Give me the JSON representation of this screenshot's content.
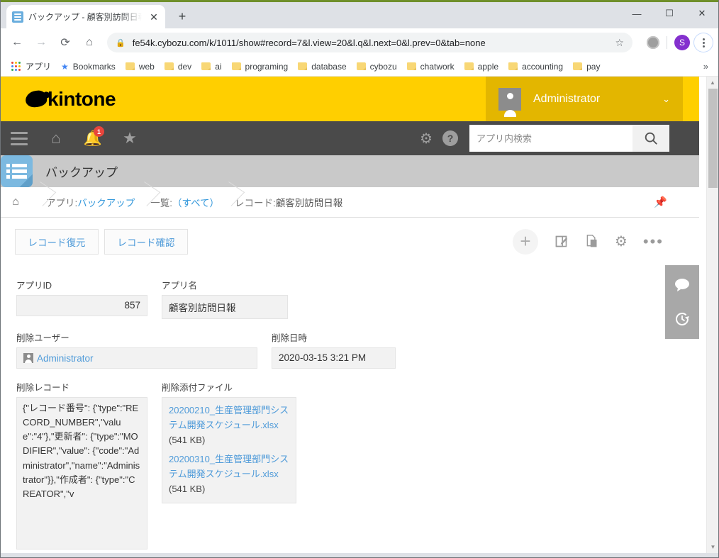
{
  "browser": {
    "tab": {
      "title": "バックアップ - 顧客別訪問日報 - レコ",
      "favicon": "app-list-icon",
      "close": "✕"
    },
    "new_tab_label": "+",
    "window_controls": {
      "minimize": "—",
      "maximize": "☐",
      "close": "✕"
    },
    "nav": {
      "back": "←",
      "forward": "→",
      "reload": "⟳",
      "home": "⌂"
    },
    "omnibox": {
      "lock_icon": "lock-icon",
      "url": "fe54k.cybozu.com/k/1011/show#record=7&l.view=20&l.q&l.next=0&l.prev=0&tab=none",
      "star": "☆"
    },
    "profile_initial": "S",
    "bookmarks": [
      {
        "label": "アプリ",
        "icon": "apps-grid-icon"
      },
      {
        "label": "Bookmarks",
        "icon": "star-icon"
      },
      {
        "label": "web",
        "icon": "folder-icon"
      },
      {
        "label": "dev",
        "icon": "folder-icon"
      },
      {
        "label": "ai",
        "icon": "folder-icon"
      },
      {
        "label": "programing",
        "icon": "folder-icon"
      },
      {
        "label": "database",
        "icon": "folder-icon"
      },
      {
        "label": "cybozu",
        "icon": "folder-icon"
      },
      {
        "label": "chatwork",
        "icon": "folder-icon"
      },
      {
        "label": "apple",
        "icon": "folder-icon"
      },
      {
        "label": "accounting",
        "icon": "folder-icon"
      },
      {
        "label": "pay",
        "icon": "folder-icon"
      }
    ],
    "bookmarks_overflow": "»"
  },
  "kintone": {
    "brand": "kintone",
    "user": {
      "name": "Administrator",
      "caret": "⌄"
    },
    "nav": {
      "notification_badge": "1",
      "search_placeholder": "アプリ内検索",
      "search_value": ""
    },
    "app": {
      "title": "バックアップ"
    },
    "breadcrumb": {
      "app_label": "アプリ:",
      "app_name": "バックアップ",
      "view_label": "一覧:",
      "view_name": "（すべて）",
      "record_label": "レコード:",
      "record_name": "顧客別訪問日報"
    },
    "actions": {
      "restore_record": "レコード復元",
      "check_record": "レコード確認"
    },
    "form": {
      "app_id_label": "アプリID",
      "app_id_value": "857",
      "app_name_label": "アプリ名",
      "app_name_value": "顧客別訪問日報",
      "delete_user_label": "削除ユーザー",
      "delete_user_value": "Administrator",
      "delete_datetime_label": "削除日時",
      "delete_datetime_value": "2020-03-15 3:21 PM",
      "delete_record_label": "削除レコード",
      "delete_record_value": "{\"レコード番号\": {\"type\":\"RECORD_NUMBER\",\"value\":\"4\"},\"更新者\": {\"type\":\"MODIFIER\",\"value\": {\"code\":\"Administrator\",\"name\":\"Administrator\"}},\"作成者\": {\"type\":\"CREATOR\",\"v",
      "delete_files_label": "削除添付ファイル",
      "files": [
        {
          "name": "20200210_生産管理部門システム開発スケジュール.xlsx",
          "size": "(541 KB)"
        },
        {
          "name": "20200310_生産管理部門システム開発スケジュール.xlsx",
          "size": "(541 KB)"
        }
      ]
    }
  },
  "colors": {
    "brand_yellow": "#ffcf00",
    "brand_yellow_dark": "#e3b600",
    "nav_dark": "#4a4a4a",
    "link_blue": "#4f9bd9",
    "badge_red": "#e8453c",
    "app_icon_blue": "#7cb9e0"
  }
}
